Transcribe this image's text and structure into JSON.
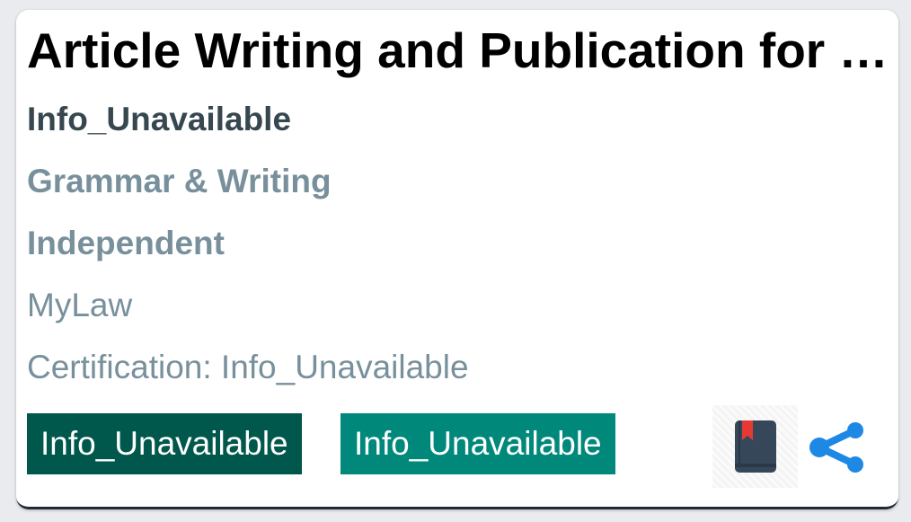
{
  "card": {
    "title": "Article Writing and Publication for Lawyers",
    "author": "Info_Unavailable",
    "category": "Grammar & Writing",
    "type": "Independent",
    "provider": "MyLaw",
    "certification": "Certification: Info_Unavailable",
    "tags": [
      "Info_Unavailable",
      "Info_Unavailable"
    ]
  },
  "colors": {
    "tag_dark": "#00574b",
    "tag_light": "#00897b",
    "share_icon": "#1e88e5",
    "book_icon": "#37475a",
    "bookmark": "#e53935"
  },
  "icons": {
    "book": "book-bookmark-icon",
    "share": "share-icon"
  }
}
